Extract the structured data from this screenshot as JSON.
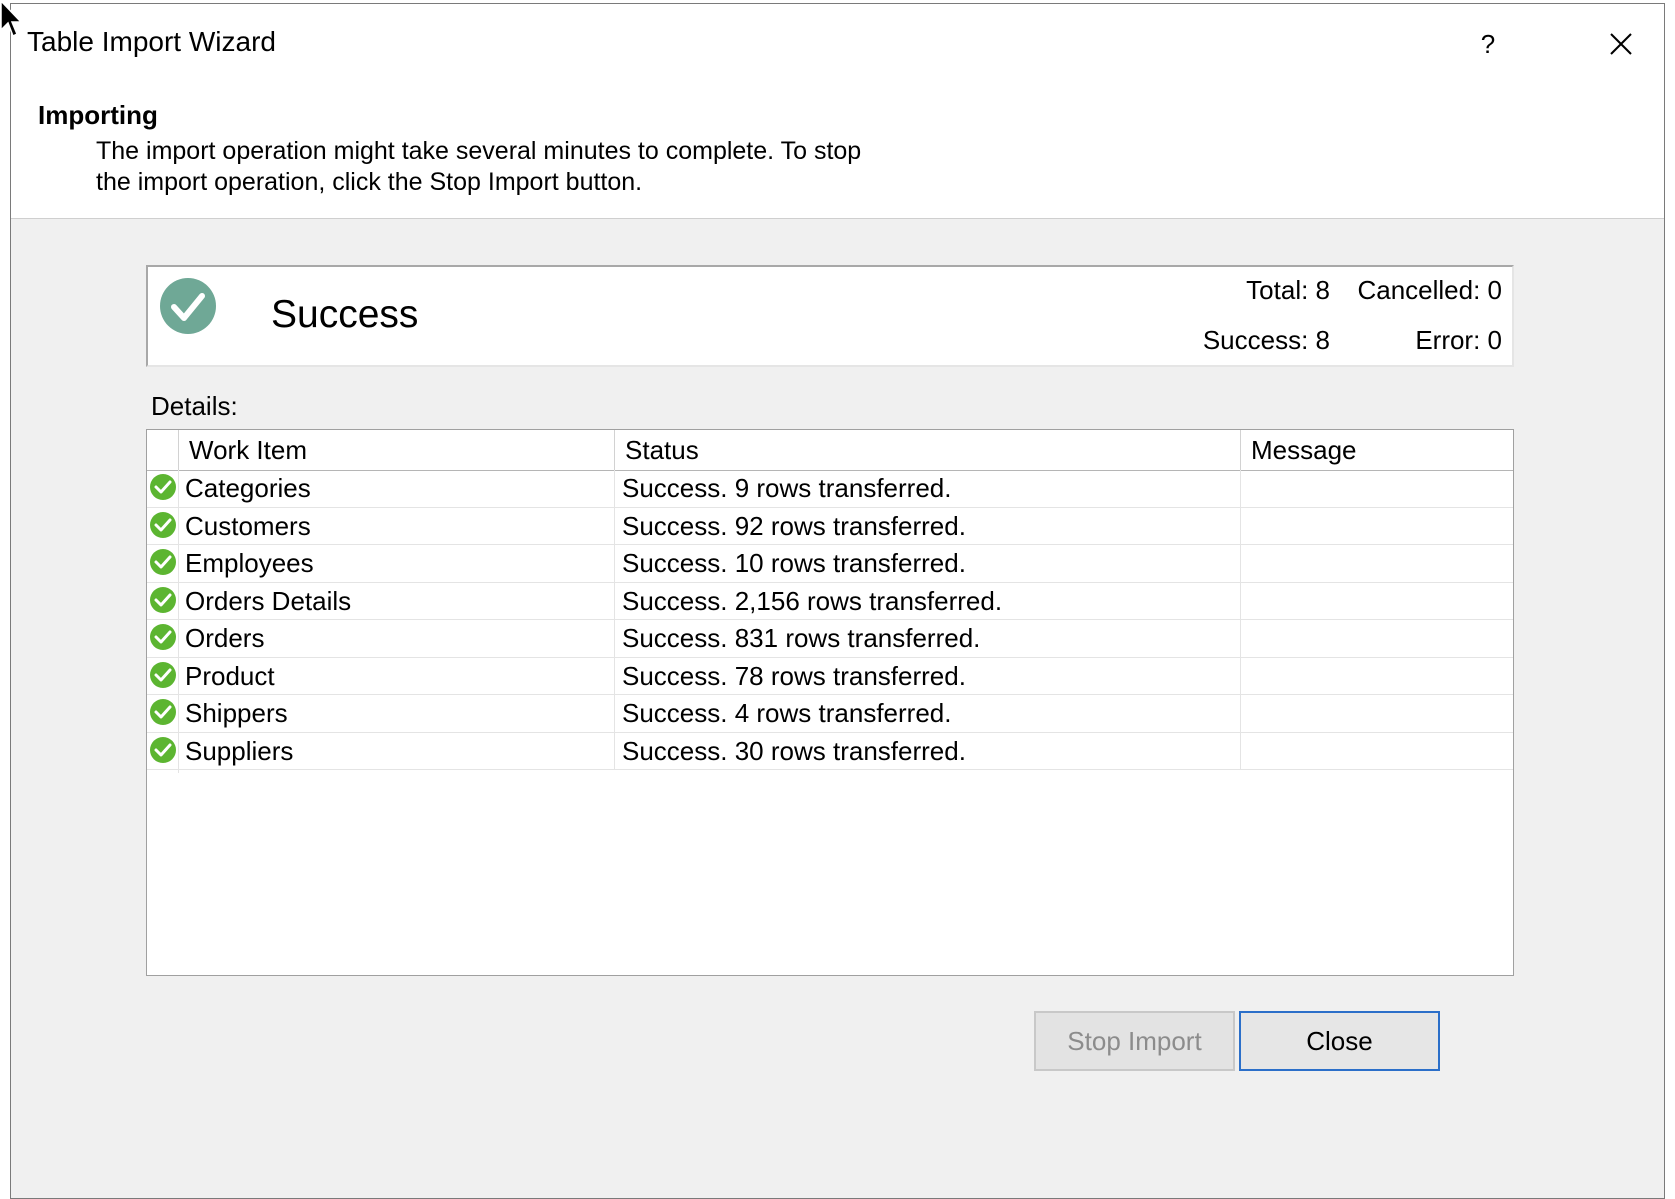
{
  "window": {
    "title": "Table Import Wizard",
    "help_label": "?",
    "close_icon": "close-icon"
  },
  "header": {
    "title": "Importing",
    "description": "The import operation might take several minutes to complete. To stop the import operation, click the Stop Import button."
  },
  "summary": {
    "status": "Success",
    "status_icon": "success-check-icon",
    "total": "Total: 8",
    "cancelled": "Cancelled: 0",
    "success": "Success: 8",
    "error": "Error: 0"
  },
  "details": {
    "label": "Details:",
    "columns": [
      "Work Item",
      "Status",
      "Message"
    ],
    "rows": [
      {
        "work_item": "Categories",
        "status": "Success. 9 rows transferred.",
        "message": ""
      },
      {
        "work_item": "Customers",
        "status": "Success. 92 rows transferred.",
        "message": ""
      },
      {
        "work_item": "Employees",
        "status": "Success. 10 rows transferred.",
        "message": ""
      },
      {
        "work_item": "Orders Details",
        "status": "Success. 2,156 rows transferred.",
        "message": ""
      },
      {
        "work_item": "Orders",
        "status": "Success. 831 rows transferred.",
        "message": ""
      },
      {
        "work_item": "Product",
        "status": "Success. 78 rows transferred.",
        "message": ""
      },
      {
        "work_item": "Shippers",
        "status": "Success. 4 rows transferred.",
        "message": ""
      },
      {
        "work_item": "Suppliers",
        "status": "Success. 30 rows transferred.",
        "message": ""
      }
    ]
  },
  "buttons": {
    "stop_import": "Stop Import",
    "close": "Close"
  },
  "colors": {
    "accent_border": "#2b6fc9",
    "success_green": "#5cb531",
    "summary_check": "#6fa896"
  }
}
